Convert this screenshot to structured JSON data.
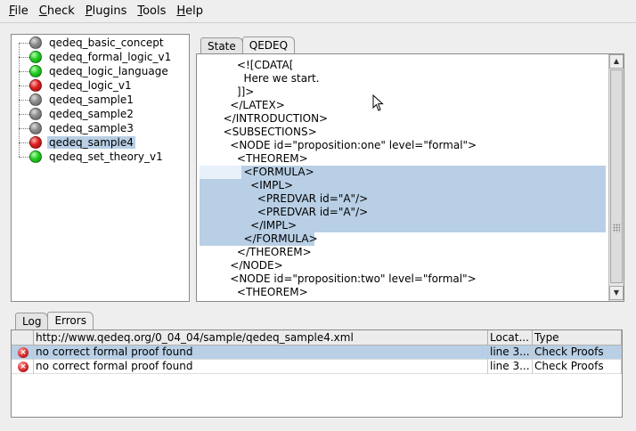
{
  "menu": [
    {
      "label": "File",
      "mnemonic": "F",
      "rest": "ile"
    },
    {
      "label": "Check",
      "mnemonic": "C",
      "rest": "heck"
    },
    {
      "label": "Plugins",
      "mnemonic": "P",
      "rest": "lugins"
    },
    {
      "label": "Tools",
      "mnemonic": "T",
      "rest": "ools"
    },
    {
      "label": "Help",
      "mnemonic": "H",
      "rest": "elp"
    }
  ],
  "tree": {
    "items": [
      {
        "label": "qedeq_basic_concept",
        "status": "grey",
        "selected": false
      },
      {
        "label": "qedeq_formal_logic_v1",
        "status": "green",
        "selected": false
      },
      {
        "label": "qedeq_logic_language",
        "status": "green",
        "selected": false
      },
      {
        "label": "qedeq_logic_v1",
        "status": "red",
        "selected": false
      },
      {
        "label": "qedeq_sample1",
        "status": "grey",
        "selected": false
      },
      {
        "label": "qedeq_sample2",
        "status": "grey",
        "selected": false
      },
      {
        "label": "qedeq_sample3",
        "status": "grey",
        "selected": false
      },
      {
        "label": "qedeq_sample4",
        "status": "red",
        "selected": true
      },
      {
        "label": "qedeq_set_theory_v1",
        "status": "green",
        "selected": false
      }
    ]
  },
  "top_tabs": [
    {
      "label": "State",
      "active": false
    },
    {
      "label": "QEDEQ",
      "active": true
    }
  ],
  "editor": {
    "lines": [
      {
        "text": "      <![CDATA[",
        "indent": 0
      },
      {
        "text": "        Here we start.",
        "indent": 0
      },
      {
        "text": "      ]]>",
        "indent": 0
      },
      {
        "text": "    </LATEX>",
        "indent": 0
      },
      {
        "text": "  </INTRODUCTION>",
        "indent": 0
      },
      {
        "text": "  <SUBSECTIONS>",
        "indent": 0
      },
      {
        "text": "    <NODE id=\"proposition:one\" level=\"formal\">",
        "indent": 0
      },
      {
        "text": "      <THEOREM>",
        "indent": 0
      },
      {
        "text": "        <FORMULA>",
        "indent": 0
      },
      {
        "text": "          <IMPL>",
        "indent": 0
      },
      {
        "text": "            <PREDVAR id=\"A\"/>",
        "indent": 0
      },
      {
        "text": "            <PREDVAR id=\"A\"/>",
        "indent": 0
      },
      {
        "text": "          </IMPL>",
        "indent": 0
      },
      {
        "text": "        </FORMULA>",
        "indent": 0
      },
      {
        "text": "      </THEOREM>",
        "indent": 0
      },
      {
        "text": "    </NODE>",
        "indent": 0
      },
      {
        "text": "    <NODE id=\"proposition:two\" level=\"formal\">",
        "indent": 0
      },
      {
        "text": "      <THEOREM>",
        "indent": 0
      }
    ]
  },
  "bottom_tabs": [
    {
      "label": "Log",
      "active": false
    },
    {
      "label": "Errors",
      "active": true
    }
  ],
  "errors_table": {
    "headers": [
      "",
      "http://www.qedeq.org/0_04_04/sample/qedeq_sample4.xml",
      "Locat...",
      "Type"
    ],
    "rows": [
      {
        "icon": "error-icon",
        "message": "no correct formal proof found",
        "location": "line 3...",
        "type": "Check Proofs",
        "selected": true
      },
      {
        "icon": "error-icon",
        "message": "no correct formal proof found",
        "location": "line 3...",
        "type": "Check Proofs",
        "selected": false
      }
    ]
  },
  "colors": {
    "selection": "#b8cfe5",
    "ok": "#22cc22",
    "error": "#dd2020",
    "unchecked": "#8c8c8c"
  }
}
